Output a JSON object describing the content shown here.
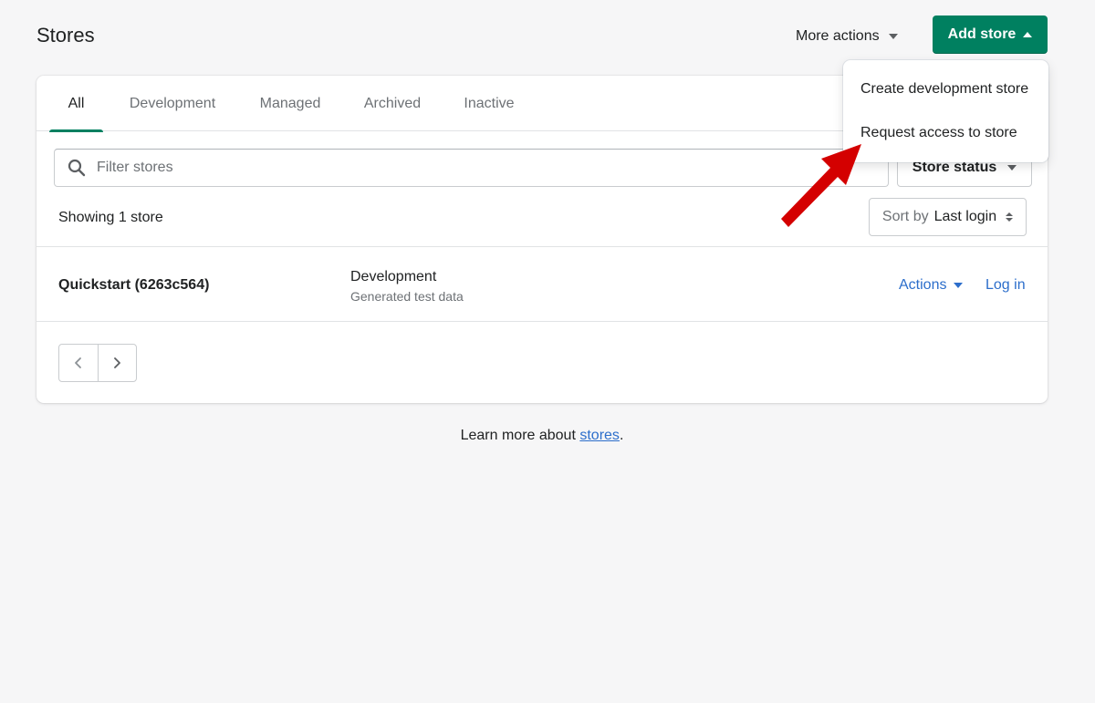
{
  "header": {
    "title": "Stores",
    "more_actions_label": "More actions",
    "add_store_label": "Add store"
  },
  "tabs": [
    {
      "label": "All"
    },
    {
      "label": "Development"
    },
    {
      "label": "Managed"
    },
    {
      "label": "Archived"
    },
    {
      "label": "Inactive"
    }
  ],
  "active_tab": "All",
  "filter": {
    "placeholder": "Filter stores",
    "value": "",
    "store_status_label": "Store status"
  },
  "summary": {
    "showing_text": "Showing 1 store",
    "sort_prefix": "Sort by",
    "sort_value": "Last login"
  },
  "stores": [
    {
      "name": "Quickstart (6263c564)",
      "type": "Development",
      "subtitle": "Generated test data",
      "actions_label": "Actions",
      "login_label": "Log in"
    }
  ],
  "pagination": {
    "prev_glyph": "‹",
    "next_glyph": "›"
  },
  "footer": {
    "text": "Learn more about",
    "link_label": "stores",
    "suffix": "."
  },
  "dropdown": {
    "items": [
      {
        "label": "Create development store"
      },
      {
        "label": "Request access to store"
      }
    ]
  },
  "colors": {
    "primary": "#008060",
    "link": "#2c6ecb",
    "annotation_arrow": "#d40000",
    "background": "#f6f6f7"
  }
}
